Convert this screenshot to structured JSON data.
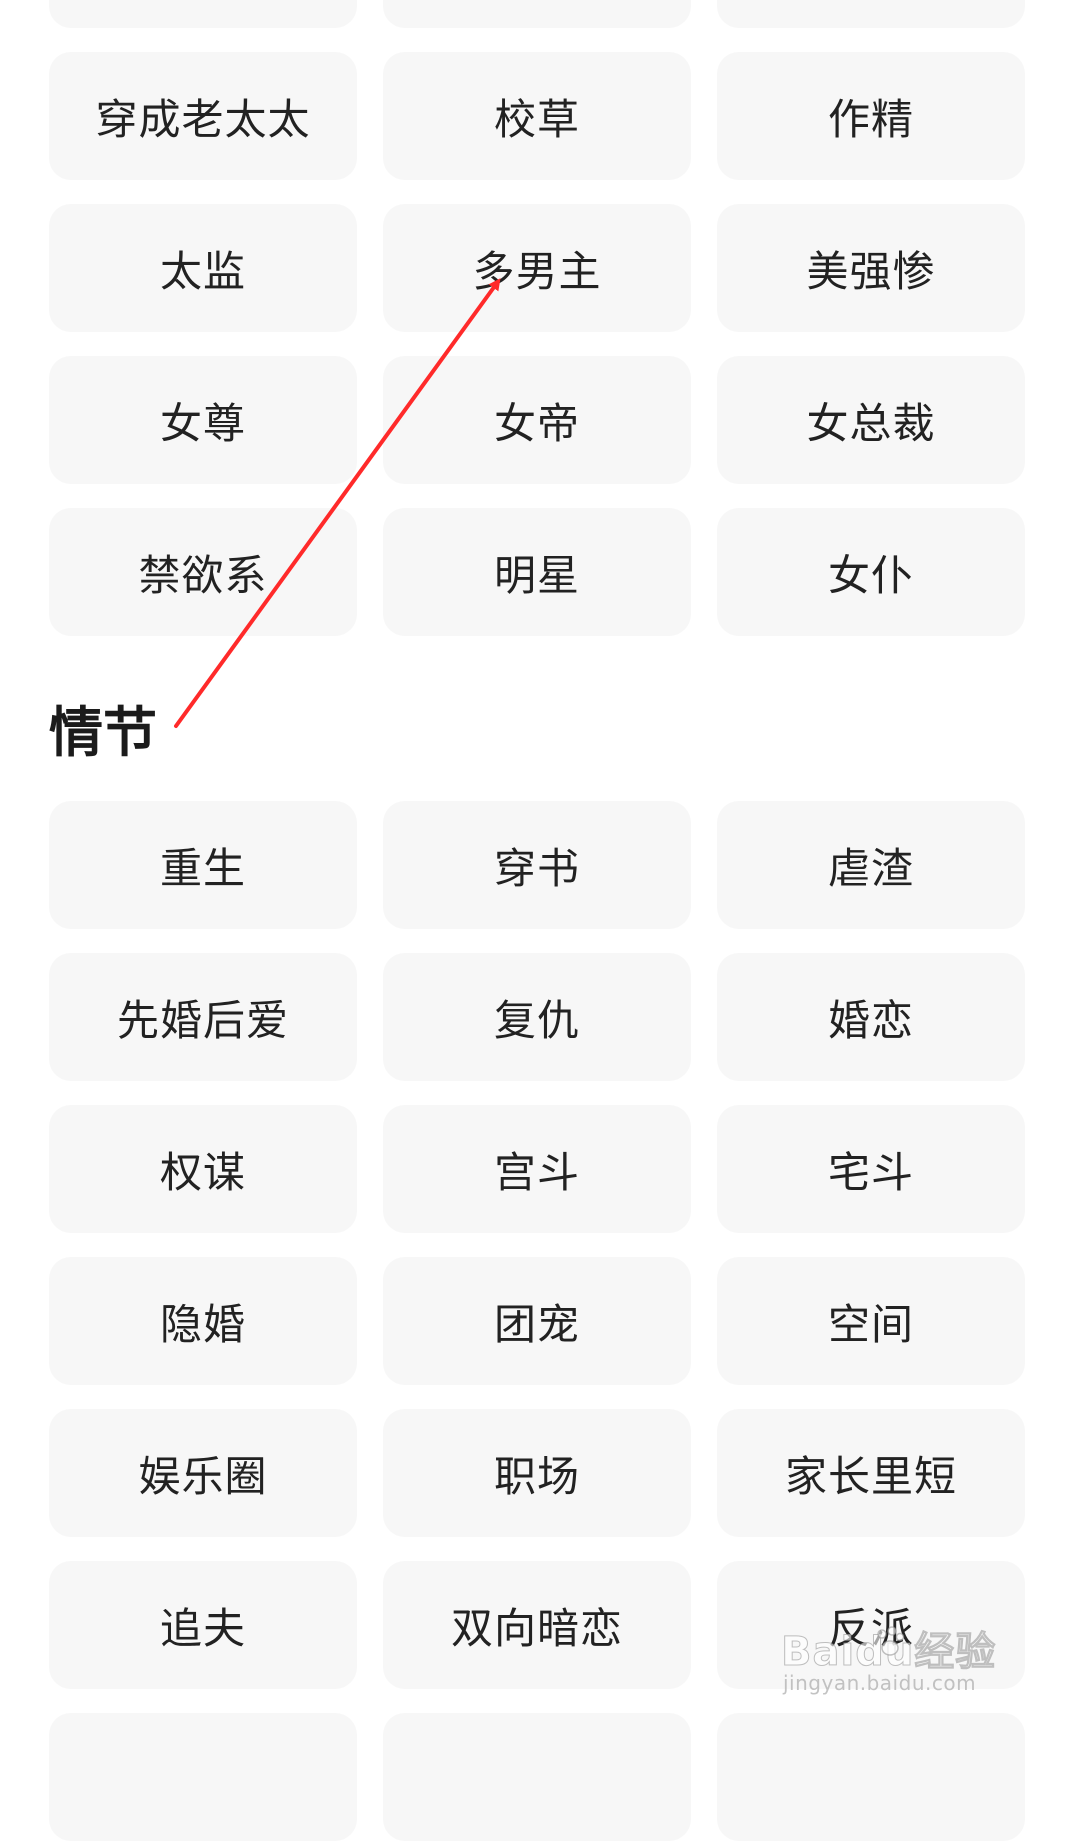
{
  "top_tags": [
    "",
    "",
    "",
    "穿成老太太",
    "校草",
    "作精",
    "太监",
    "多男主",
    "美强惨",
    "女尊",
    "女帝",
    "女总裁",
    "禁欲系",
    "明星",
    "女仆"
  ],
  "plot_section": {
    "title": "情节",
    "tags": [
      "重生",
      "穿书",
      "虐渣",
      "先婚后爱",
      "复仇",
      "婚恋",
      "权谋",
      "宫斗",
      "宅斗",
      "隐婚",
      "团宠",
      "空间",
      "娱乐圈",
      "职场",
      "家长里短",
      "追夫",
      "双向暗恋",
      "反派",
      "",
      "",
      ""
    ]
  },
  "annotation": {
    "arrow_color": "#ff2a2a",
    "arrow_target": "多男主"
  },
  "watermark": {
    "brand": "Baidu经验",
    "url": "jingyan.baidu.com"
  },
  "colors": {
    "tag_bg": "#f7f7f7",
    "tag_text": "#222222",
    "title_text": "#1b1b1b"
  },
  "icons": {
    "watermark": "baidu-paw-icon"
  }
}
